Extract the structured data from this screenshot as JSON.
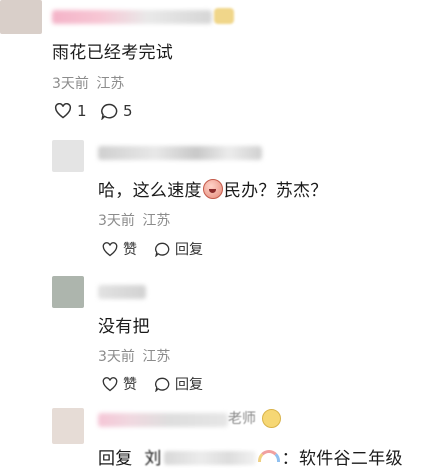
{
  "comments": [
    {
      "text": "雨花已经考完试",
      "time": "3天前",
      "location": "江苏",
      "like_count": "1",
      "reply_count": "5"
    },
    {
      "text_prefix": "哈，这么速度",
      "text_suffix": "民办？苏杰？",
      "time": "3天前",
      "location": "江苏",
      "like_label": "赞",
      "reply_label": "回复"
    },
    {
      "text": "没有把",
      "time": "3天前",
      "location": "江苏",
      "like_label": "赞",
      "reply_label": "回复"
    },
    {
      "name_visible_suffix": "老师",
      "text_prefix": "回复",
      "text_partial": "刘",
      "text_suffix": "：软件谷二年级"
    }
  ],
  "icons": {
    "like": "heart-outline-icon",
    "reply": "speech-bubble-icon",
    "emoji_face": "blushing-face-emoji",
    "emoji_rainbow": "rainbow-emoji",
    "emoji_smile": "smile-emoji"
  },
  "colors": {
    "meta_text": "#8c8c8c",
    "main_text": "#1a1a1a"
  }
}
